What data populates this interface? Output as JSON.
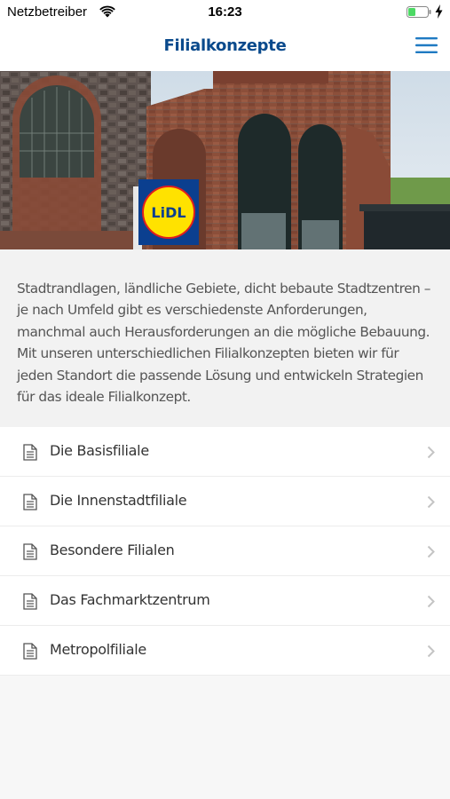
{
  "status_bar": {
    "carrier": "Netzbetreiber",
    "time": "16:23",
    "icons": [
      "wifi-icon",
      "battery-icon",
      "charging-icon"
    ]
  },
  "nav": {
    "title": "Filialkonzepte",
    "menu_icon": "hamburger-menu-icon",
    "title_color": "#0a4a8c"
  },
  "hero": {
    "description_icon": "photo of a brick building with store sign",
    "sign_text": "LiDL"
  },
  "intro": {
    "text": "Stadtrandlagen, ländliche Gebiete, dicht bebaute Stadtzentren – je nach Umfeld gibt es verschiedenste Anforderungen, manchmal auch Herausforderungen an die mögliche Bebauung. Mit unseren unterschiedlichen Filialkonzepten bieten wir für jeden Standort die passende Lösung und entwickeln Strategien für das ideale Filialkonzept."
  },
  "list": {
    "items": [
      {
        "label": "Die Basisfiliale",
        "icon": "document-icon"
      },
      {
        "label": "Die Innenstadtfiliale",
        "icon": "document-icon"
      },
      {
        "label": "Besondere Filialen",
        "icon": "document-icon"
      },
      {
        "label": "Das Fachmarktzentrum",
        "icon": "document-icon"
      },
      {
        "label": "Metropolfiliale",
        "icon": "document-icon"
      }
    ]
  },
  "colors": {
    "accent": "#0a4a8c",
    "battery_green": "#4cd964"
  }
}
